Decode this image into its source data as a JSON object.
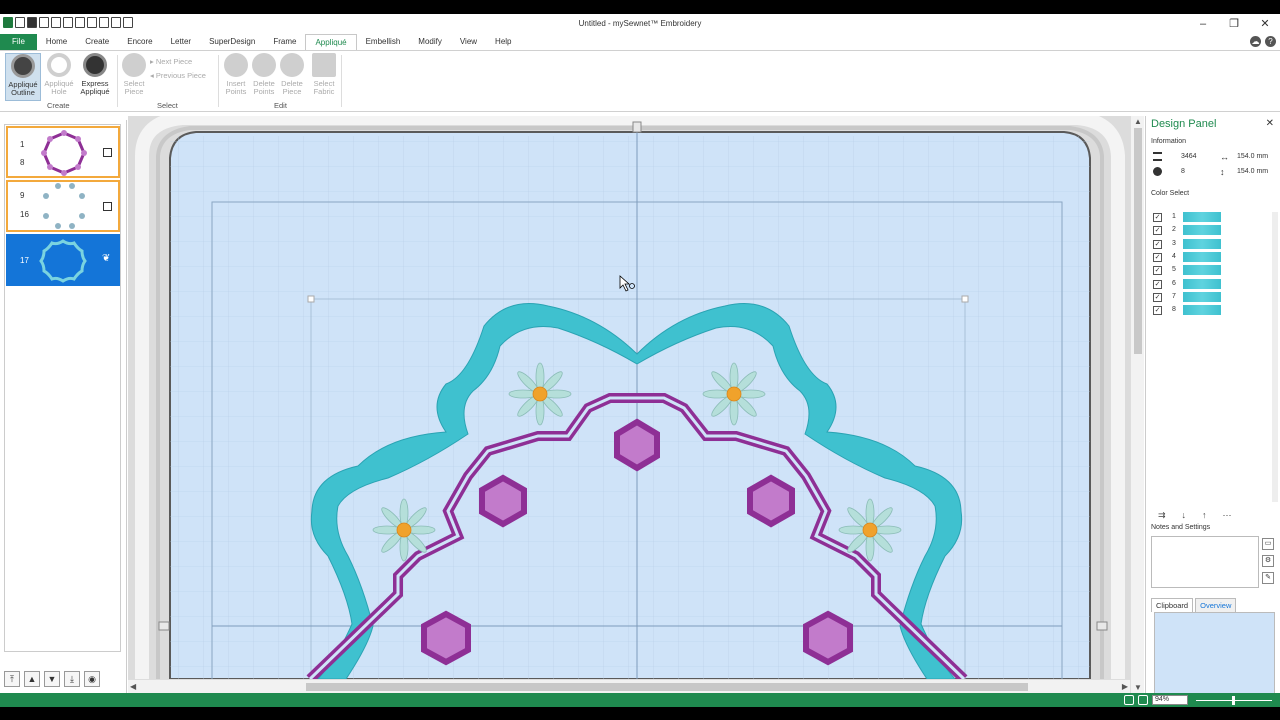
{
  "window": {
    "title": "Untitled - mySewnet™ Embroidery"
  },
  "tabs": [
    "File",
    "Home",
    "Create",
    "Encore",
    "Letter",
    "SuperDesign",
    "Frame",
    "Appliqué",
    "Embellish",
    "Modify",
    "View",
    "Help"
  ],
  "active_tab": "Appliqué",
  "ribbon": {
    "applique_outline": "Appliqué Outline",
    "applique_hole": "Appliqué Hole",
    "express_applique": "Express Appliqué",
    "group_create": "Create",
    "select_piece": "Select Piece",
    "next_piece": "Next Piece",
    "previous_piece": "Previous Piece",
    "group_select": "Select",
    "insert_points": "Insert Points",
    "delete_points": "Delete Points",
    "delete_piece": "Delete Piece",
    "select_fabric": "Select Fabric",
    "group_edit": "Edit"
  },
  "thumbnails": [
    {
      "top": "1",
      "bottom": "8"
    },
    {
      "top": "9",
      "bottom": "16"
    },
    {
      "top": "17",
      "bottom": ""
    }
  ],
  "design_panel": {
    "title": "Design Panel",
    "info_label": "Information",
    "stitches": "3464",
    "width": "154.0 mm",
    "colors": "8",
    "height": "154.0 mm",
    "color_select_label": "Color Select",
    "color_rows": [
      "1",
      "2",
      "3",
      "4",
      "5",
      "6",
      "7",
      "8"
    ],
    "color_swatch": "#3fc1cf",
    "notes_label": "Notes and Settings",
    "tab_clipboard": "Clipboard",
    "tab_overview": "Overview"
  },
  "status": {
    "zoom": "94%"
  },
  "colors": {
    "accent": "#1f8a4f",
    "selected_thumb": "#1475d8",
    "teal_stitch": "#3fc1cf",
    "purple_stitch": "#8e2f95",
    "hoop_fill": "#cfe3f8"
  }
}
